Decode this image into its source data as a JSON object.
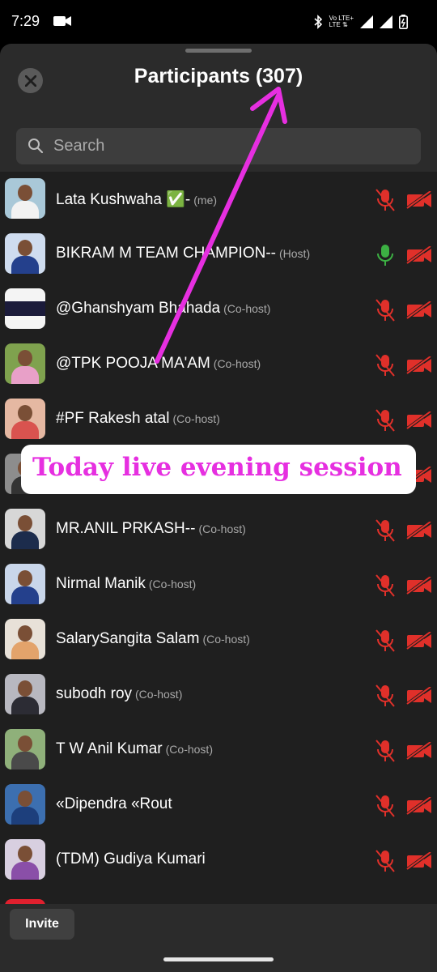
{
  "status": {
    "time": "7:29",
    "network": "Vo LTE+",
    "network_sub": "LTE ⇅"
  },
  "header": {
    "title": "Participants (307)"
  },
  "search": {
    "placeholder": "Search"
  },
  "participants": [
    {
      "name": "Lata Kushwaha ✅-",
      "role": "(me)",
      "mic": "muted",
      "camera": "off"
    },
    {
      "name": "BIKRAM M TEAM CHAMPION--",
      "role": "(Host)",
      "mic": "on",
      "camera": "off"
    },
    {
      "name": "@Ghanshyam Bhahada",
      "role": "(Co-host)",
      "mic": "muted",
      "camera": "off"
    },
    {
      "name": "@TPK POOJA MA'AM",
      "role": "(Co-host)",
      "mic": "muted",
      "camera": "off"
    },
    {
      "name": "#PF Rakesh atal",
      "role": "(Co-host)",
      "mic": "muted",
      "camera": "off"
    },
    {
      "name": "",
      "role": "",
      "mic": "muted",
      "camera": "off"
    },
    {
      "name": "MR.ANIL PRKASH--",
      "role": "(Co-host)",
      "mic": "muted",
      "camera": "off"
    },
    {
      "name": "Nirmal Manik",
      "role": "(Co-host)",
      "mic": "muted",
      "camera": "off"
    },
    {
      "name": "SalarySangita Salam",
      "role": "(Co-host)",
      "mic": "muted",
      "camera": "off"
    },
    {
      "name": "subodh roy",
      "role": "(Co-host)",
      "mic": "muted",
      "camera": "off"
    },
    {
      "name": "T W Anil Kumar",
      "role": "(Co-host)",
      "mic": "muted",
      "camera": "off"
    },
    {
      "name": "«Dipendra «Rout",
      "role": "",
      "mic": "muted",
      "camera": "off"
    },
    {
      "name": "(TDM) Gudiya Kumari",
      "role": "",
      "mic": "muted",
      "camera": "off"
    }
  ],
  "overlay": {
    "text": "Today live evening session"
  },
  "footer": {
    "invite_label": "Invite"
  },
  "colors": {
    "sheet": "#2b2b2b",
    "list": "#1f1f1f",
    "muted": "#e0302a",
    "mic_on": "#3cb043",
    "overlay_text": "#e62fe0",
    "arrow": "#e62fe0"
  },
  "icons": [
    "close-icon",
    "search-icon",
    "mic-muted-icon",
    "mic-on-icon",
    "camera-off-icon",
    "video-camera-icon",
    "bluetooth-icon",
    "signal-icon",
    "battery-icon"
  ]
}
